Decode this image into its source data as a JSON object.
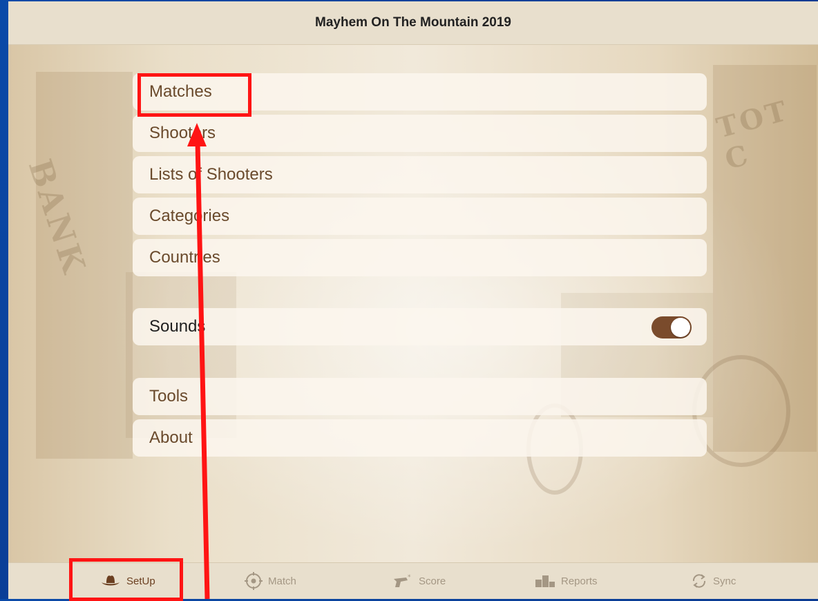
{
  "window": {
    "title": "Mayhem On The Mountain 2019"
  },
  "background": {
    "sign_left": "BANK",
    "sign_right": "TOT C"
  },
  "menu_group_1": [
    {
      "label": "Matches"
    },
    {
      "label": "Shooters"
    },
    {
      "label": "Lists of Shooters"
    },
    {
      "label": "Categories"
    },
    {
      "label": "Countries"
    }
  ],
  "settings": {
    "sounds_label": "Sounds",
    "sounds_enabled": true
  },
  "menu_group_2": [
    {
      "label": "Tools"
    },
    {
      "label": "About"
    }
  ],
  "tabbar": {
    "tabs": [
      {
        "label": "SetUp",
        "icon": "cowboy-hat-icon",
        "active": true
      },
      {
        "label": "Match",
        "icon": "crosshair-icon",
        "active": false
      },
      {
        "label": "Score",
        "icon": "revolver-icon",
        "active": false
      },
      {
        "label": "Reports",
        "icon": "podium-icon",
        "active": false
      },
      {
        "label": "Sync",
        "icon": "sync-icon",
        "active": false
      }
    ]
  },
  "colors": {
    "accent": "#6b3f20",
    "toggle_on": "#7a4b2c",
    "annotation": "#ff1414",
    "outer_background": "#0b4aa8"
  }
}
